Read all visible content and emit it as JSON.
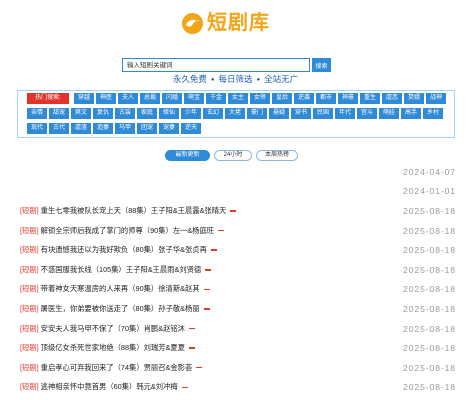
{
  "colors": {
    "brand_gold": "#f2a516",
    "accent_blue": "#2f8ad8",
    "slogan_blue": "#1f5fae",
    "tag_red": "#e2322b",
    "badge_red": "#e03a2f"
  },
  "logo": {
    "icon": "logo-icon",
    "text": "短剧库"
  },
  "search": {
    "placeholder": "输入短剧关键词",
    "button_label": "搜索"
  },
  "slogan": {
    "items": [
      "永久免费",
      "每日筛选",
      "全站无广"
    ],
    "separator": "●"
  },
  "tags": {
    "label": "热门搜索:",
    "rows": [
      [
        "穿越",
        "神医",
        "夫人",
        "总裁",
        "闪婚",
        "萌宝",
        "千金",
        "女主",
        "女帝",
        "皇后",
        "逆袭",
        "都市",
        "神豪",
        "重生",
        "虐恋",
        "赘婿",
        "战神"
      ],
      [
        "亲情",
        "甜宠",
        "爽文",
        "复仇",
        "古装",
        "家庭",
        "修仙",
        "少年",
        "玄幻",
        "大佬",
        "豪门",
        "悬疑",
        "穿书",
        "民国",
        "年代",
        "宫斗",
        "萌娃",
        "高手",
        "乡村"
      ],
      [
        "现代",
        "古代",
        "虐渣",
        "追妻",
        "马甲",
        "团宠",
        "宠妻",
        "逆天"
      ]
    ]
  },
  "tabs": [
    {
      "label": "最新更新",
      "active": true
    },
    {
      "label": "24小时",
      "active": false
    },
    {
      "label": "本周热榜",
      "active": false
    }
  ],
  "list": {
    "badge": "[短剧]",
    "notices": [
      {
        "date": "2024-04-07"
      },
      {
        "date": "2024-01-01"
      }
    ],
    "items": [
      {
        "title": "重生七零我被队长宠上天（88集）王子阳&王晨露&张晴天",
        "date": "2025-08-18"
      },
      {
        "title": "解锁全宗师后我成了掌门的师尊（90集）左一&杨庭旺",
        "date": "2025-08-18"
      },
      {
        "title": "有块遗憾我还以为我好欺负（80集）张子华&张贞再",
        "date": "2025-08-18"
      },
      {
        "title": "不惑国服我长线（105集）王子阳&王晨雨&刘贤德",
        "date": "2025-08-18"
      },
      {
        "title": "带着神女天寒温房的人来再（90集）徐清斯&赵其",
        "date": "2025-08-18"
      },
      {
        "title": "屠医生，你弟要被你送走了（80集）孙子敬&杨丽",
        "date": "2025-08-18"
      },
      {
        "title": "安安夫人我马甲不保了（70集）肖鹏&赵铭沐",
        "date": "2025-08-18"
      },
      {
        "title": "顶级亿女杀死世家地绝（88集）刘瑞芳&夏夏",
        "date": "2025-08-18"
      },
      {
        "title": "重启孝心可弃我回来了（74集）贾丽召&金影荟",
        "date": "2025-08-18"
      },
      {
        "title": "逃神相亲怀中竟首男（60集）韩元&刘冲梅",
        "date": "2025-08-18"
      }
    ]
  }
}
